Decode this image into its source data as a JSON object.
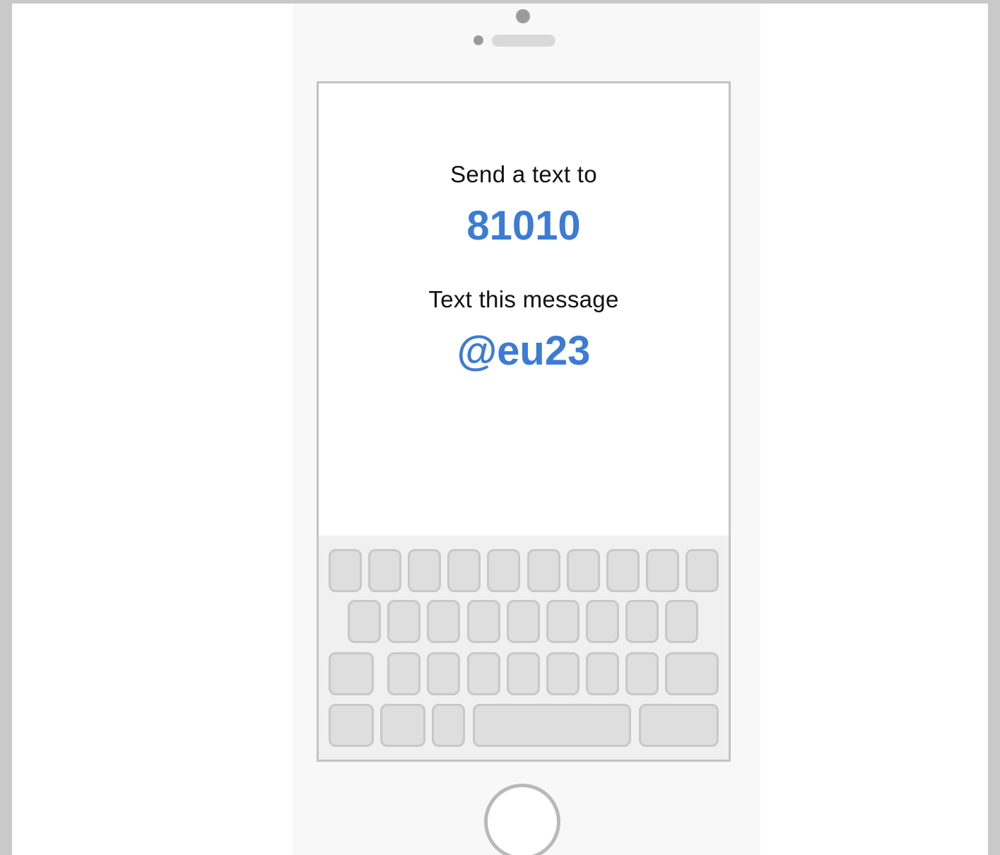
{
  "instructions": {
    "send_label": "Send a text to",
    "number": "81010",
    "message_label": "Text this message",
    "message_code": "@eu23"
  },
  "colors": {
    "accent": "#3c7bd6",
    "text": "#111111",
    "frame": "#c3c3c3",
    "key_fill": "#dedede",
    "key_border": "#c8c8c8",
    "keyboard_bg": "#f0f0f0"
  },
  "icons": {
    "camera": "camera-icon",
    "speaker": "speaker-icon",
    "home": "home-button-icon"
  }
}
